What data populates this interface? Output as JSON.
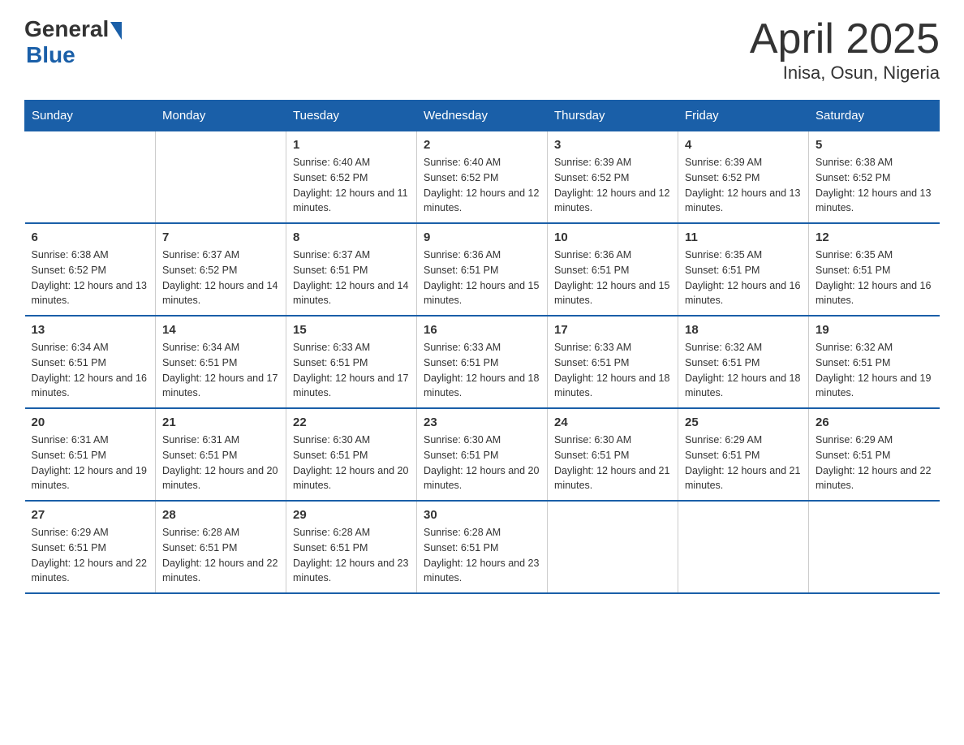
{
  "logo": {
    "general": "General",
    "blue": "Blue"
  },
  "title": "April 2025",
  "subtitle": "Inisa, Osun, Nigeria",
  "weekdays": [
    "Sunday",
    "Monday",
    "Tuesday",
    "Wednesday",
    "Thursday",
    "Friday",
    "Saturday"
  ],
  "weeks": [
    [
      {
        "day": "",
        "sunrise": "",
        "sunset": "",
        "daylight": ""
      },
      {
        "day": "",
        "sunrise": "",
        "sunset": "",
        "daylight": ""
      },
      {
        "day": "1",
        "sunrise": "Sunrise: 6:40 AM",
        "sunset": "Sunset: 6:52 PM",
        "daylight": "Daylight: 12 hours and 11 minutes."
      },
      {
        "day": "2",
        "sunrise": "Sunrise: 6:40 AM",
        "sunset": "Sunset: 6:52 PM",
        "daylight": "Daylight: 12 hours and 12 minutes."
      },
      {
        "day": "3",
        "sunrise": "Sunrise: 6:39 AM",
        "sunset": "Sunset: 6:52 PM",
        "daylight": "Daylight: 12 hours and 12 minutes."
      },
      {
        "day": "4",
        "sunrise": "Sunrise: 6:39 AM",
        "sunset": "Sunset: 6:52 PM",
        "daylight": "Daylight: 12 hours and 13 minutes."
      },
      {
        "day": "5",
        "sunrise": "Sunrise: 6:38 AM",
        "sunset": "Sunset: 6:52 PM",
        "daylight": "Daylight: 12 hours and 13 minutes."
      }
    ],
    [
      {
        "day": "6",
        "sunrise": "Sunrise: 6:38 AM",
        "sunset": "Sunset: 6:52 PM",
        "daylight": "Daylight: 12 hours and 13 minutes."
      },
      {
        "day": "7",
        "sunrise": "Sunrise: 6:37 AM",
        "sunset": "Sunset: 6:52 PM",
        "daylight": "Daylight: 12 hours and 14 minutes."
      },
      {
        "day": "8",
        "sunrise": "Sunrise: 6:37 AM",
        "sunset": "Sunset: 6:51 PM",
        "daylight": "Daylight: 12 hours and 14 minutes."
      },
      {
        "day": "9",
        "sunrise": "Sunrise: 6:36 AM",
        "sunset": "Sunset: 6:51 PM",
        "daylight": "Daylight: 12 hours and 15 minutes."
      },
      {
        "day": "10",
        "sunrise": "Sunrise: 6:36 AM",
        "sunset": "Sunset: 6:51 PM",
        "daylight": "Daylight: 12 hours and 15 minutes."
      },
      {
        "day": "11",
        "sunrise": "Sunrise: 6:35 AM",
        "sunset": "Sunset: 6:51 PM",
        "daylight": "Daylight: 12 hours and 16 minutes."
      },
      {
        "day": "12",
        "sunrise": "Sunrise: 6:35 AM",
        "sunset": "Sunset: 6:51 PM",
        "daylight": "Daylight: 12 hours and 16 minutes."
      }
    ],
    [
      {
        "day": "13",
        "sunrise": "Sunrise: 6:34 AM",
        "sunset": "Sunset: 6:51 PM",
        "daylight": "Daylight: 12 hours and 16 minutes."
      },
      {
        "day": "14",
        "sunrise": "Sunrise: 6:34 AM",
        "sunset": "Sunset: 6:51 PM",
        "daylight": "Daylight: 12 hours and 17 minutes."
      },
      {
        "day": "15",
        "sunrise": "Sunrise: 6:33 AM",
        "sunset": "Sunset: 6:51 PM",
        "daylight": "Daylight: 12 hours and 17 minutes."
      },
      {
        "day": "16",
        "sunrise": "Sunrise: 6:33 AM",
        "sunset": "Sunset: 6:51 PM",
        "daylight": "Daylight: 12 hours and 18 minutes."
      },
      {
        "day": "17",
        "sunrise": "Sunrise: 6:33 AM",
        "sunset": "Sunset: 6:51 PM",
        "daylight": "Daylight: 12 hours and 18 minutes."
      },
      {
        "day": "18",
        "sunrise": "Sunrise: 6:32 AM",
        "sunset": "Sunset: 6:51 PM",
        "daylight": "Daylight: 12 hours and 18 minutes."
      },
      {
        "day": "19",
        "sunrise": "Sunrise: 6:32 AM",
        "sunset": "Sunset: 6:51 PM",
        "daylight": "Daylight: 12 hours and 19 minutes."
      }
    ],
    [
      {
        "day": "20",
        "sunrise": "Sunrise: 6:31 AM",
        "sunset": "Sunset: 6:51 PM",
        "daylight": "Daylight: 12 hours and 19 minutes."
      },
      {
        "day": "21",
        "sunrise": "Sunrise: 6:31 AM",
        "sunset": "Sunset: 6:51 PM",
        "daylight": "Daylight: 12 hours and 20 minutes."
      },
      {
        "day": "22",
        "sunrise": "Sunrise: 6:30 AM",
        "sunset": "Sunset: 6:51 PM",
        "daylight": "Daylight: 12 hours and 20 minutes."
      },
      {
        "day": "23",
        "sunrise": "Sunrise: 6:30 AM",
        "sunset": "Sunset: 6:51 PM",
        "daylight": "Daylight: 12 hours and 20 minutes."
      },
      {
        "day": "24",
        "sunrise": "Sunrise: 6:30 AM",
        "sunset": "Sunset: 6:51 PM",
        "daylight": "Daylight: 12 hours and 21 minutes."
      },
      {
        "day": "25",
        "sunrise": "Sunrise: 6:29 AM",
        "sunset": "Sunset: 6:51 PM",
        "daylight": "Daylight: 12 hours and 21 minutes."
      },
      {
        "day": "26",
        "sunrise": "Sunrise: 6:29 AM",
        "sunset": "Sunset: 6:51 PM",
        "daylight": "Daylight: 12 hours and 22 minutes."
      }
    ],
    [
      {
        "day": "27",
        "sunrise": "Sunrise: 6:29 AM",
        "sunset": "Sunset: 6:51 PM",
        "daylight": "Daylight: 12 hours and 22 minutes."
      },
      {
        "day": "28",
        "sunrise": "Sunrise: 6:28 AM",
        "sunset": "Sunset: 6:51 PM",
        "daylight": "Daylight: 12 hours and 22 minutes."
      },
      {
        "day": "29",
        "sunrise": "Sunrise: 6:28 AM",
        "sunset": "Sunset: 6:51 PM",
        "daylight": "Daylight: 12 hours and 23 minutes."
      },
      {
        "day": "30",
        "sunrise": "Sunrise: 6:28 AM",
        "sunset": "Sunset: 6:51 PM",
        "daylight": "Daylight: 12 hours and 23 minutes."
      },
      {
        "day": "",
        "sunrise": "",
        "sunset": "",
        "daylight": ""
      },
      {
        "day": "",
        "sunrise": "",
        "sunset": "",
        "daylight": ""
      },
      {
        "day": "",
        "sunrise": "",
        "sunset": "",
        "daylight": ""
      }
    ]
  ]
}
